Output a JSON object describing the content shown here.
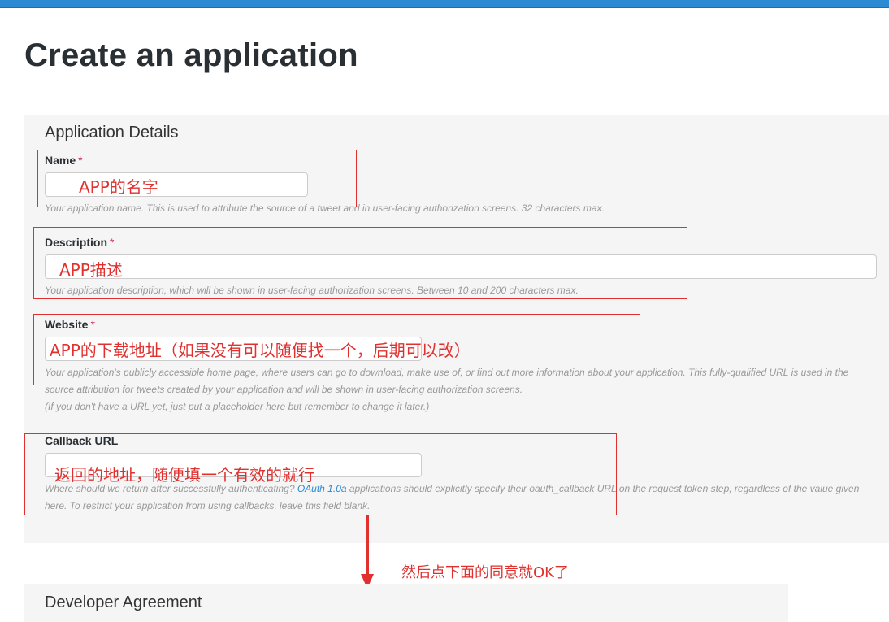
{
  "page": {
    "title": "Create an application"
  },
  "details": {
    "heading": "Application Details",
    "name": {
      "label": "Name",
      "required_mark": "*",
      "value": "",
      "help": "Your application name. This is used to attribute the source of a tweet and in user-facing authorization screens. 32 characters max."
    },
    "description": {
      "label": "Description",
      "required_mark": "*",
      "value": "",
      "help": "Your application description, which will be shown in user-facing authorization screens. Between 10 and 200 characters max."
    },
    "website": {
      "label": "Website",
      "required_mark": "*",
      "value": "",
      "help_line1": "Your application's publicly accessible home page, where users can go to download, make use of, or find out more information about your application. This fully-qualified URL is used in the",
      "help_line2": "source attribution for tweets created by your application and will be shown in user-facing authorization screens.",
      "help_line3": "(If you don't have a URL yet, just put a placeholder here but remember to change it later.)"
    },
    "callback": {
      "label": "Callback URL",
      "value": "",
      "help_before": "Where should we return after successfully authenticating? ",
      "help_link": "OAuth 1.0a",
      "help_after": " applications should explicitly specify their oauth_callback URL on the request token step, regardless of the value given",
      "help_line2": "here. To restrict your application from using callbacks, leave this field blank."
    }
  },
  "agreement": {
    "heading": "Developer Agreement"
  },
  "annotations": {
    "name": "APP的名字",
    "description": "APP描述",
    "website": "APP的下载地址（如果没有可以随便找一个，后期可以改）",
    "callback": "返回的地址，随便填一个有效的就行",
    "next_step": "然后点下面的同意就OK了",
    "color": "#e0312f"
  }
}
